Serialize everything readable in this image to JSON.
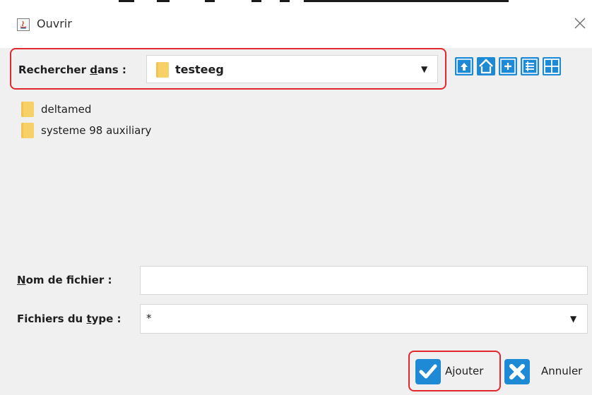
{
  "window": {
    "title": "Ouvrir",
    "close_glyph": "×"
  },
  "search": {
    "label_prefix": "Rechercher ",
    "label_mnemonic": "d",
    "label_suffix": "ans :",
    "current_folder": "testeeg"
  },
  "toolbar": {
    "icons": [
      "up-one-level-icon",
      "home-icon",
      "new-folder-icon",
      "list-view-icon",
      "details-view-icon"
    ]
  },
  "files": [
    {
      "name": "deltamed",
      "type": "folder"
    },
    {
      "name": "systeme 98 auxiliary",
      "type": "folder"
    }
  ],
  "filename": {
    "label_mnemonic": "N",
    "label_rest": "om de fichier :",
    "value": ""
  },
  "filetype": {
    "label_prefix": "Fichiers du ",
    "label_mnemonic": "t",
    "label_suffix": "ype :",
    "value": "*"
  },
  "buttons": {
    "ok_label": "Ajouter",
    "cancel_label": "Annuler"
  },
  "colors": {
    "accent": "#1e8ad6",
    "highlight": "#e0282e",
    "folder": "#f7d167"
  }
}
